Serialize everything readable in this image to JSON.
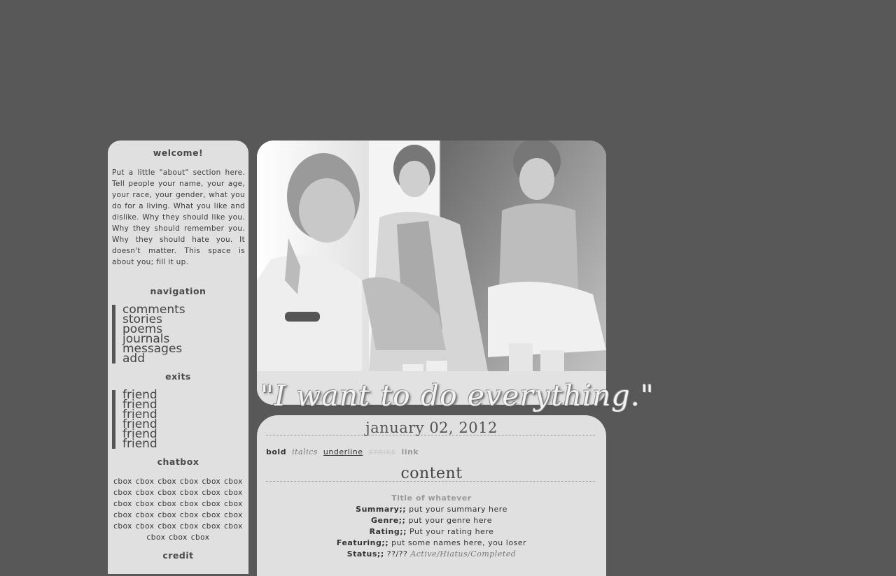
{
  "sidebar": {
    "welcome_heading": "welcome!",
    "about_text": "Put a little \"about\" section here. Tell people your name, your age, your race, your gender, what you do for a living. What you like and dislike. Why they should like you. Why they should remember you. Why they should hate you. It doesn't matter. This space is about you; fill it up.",
    "navigation_heading": "navigation",
    "navigation_items": [
      "comments",
      "stories",
      "poems",
      "journals",
      "messages",
      "add"
    ],
    "exits_heading": "exits",
    "exits_items": [
      "friend",
      "friend",
      "friend",
      "friend",
      "friend",
      "friend"
    ],
    "chatbox_heading": "chatbox",
    "chatbox_text": "cbox cbox cbox cbox cbox cbox cbox cbox cbox cbox cbox cbox cbox cbox cbox cbox cbox cbox cbox cbox cbox cbox cbox cbox cbox cbox cbox cbox cbox cbox cbox cbox cbox",
    "credit_heading": "credit"
  },
  "header": {
    "quote": "\"I want to do everything.\""
  },
  "post": {
    "date": "january 02, 2012",
    "styles": {
      "bold": "bold",
      "italics": "italics",
      "underline": "underline",
      "strike": "STRIKE",
      "link": "link"
    },
    "content_title": "content",
    "work_title": "Title of whatever",
    "fields": [
      {
        "label": "Summary;;",
        "value": "put your summary here"
      },
      {
        "label": "Genre;;",
        "value": "put your genre here"
      },
      {
        "label": "Rating;;",
        "value": "Put your rating here"
      },
      {
        "label": "Featuring;;",
        "value": "put some names here, you loser"
      }
    ],
    "status_label": "Status;;",
    "status_value": "??/??",
    "status_options": "Active/Hiatus/Completed"
  },
  "colors": {
    "page_bg": "#585858",
    "panel_bg": "#e0e0e0",
    "accent_bar": "#555555"
  }
}
